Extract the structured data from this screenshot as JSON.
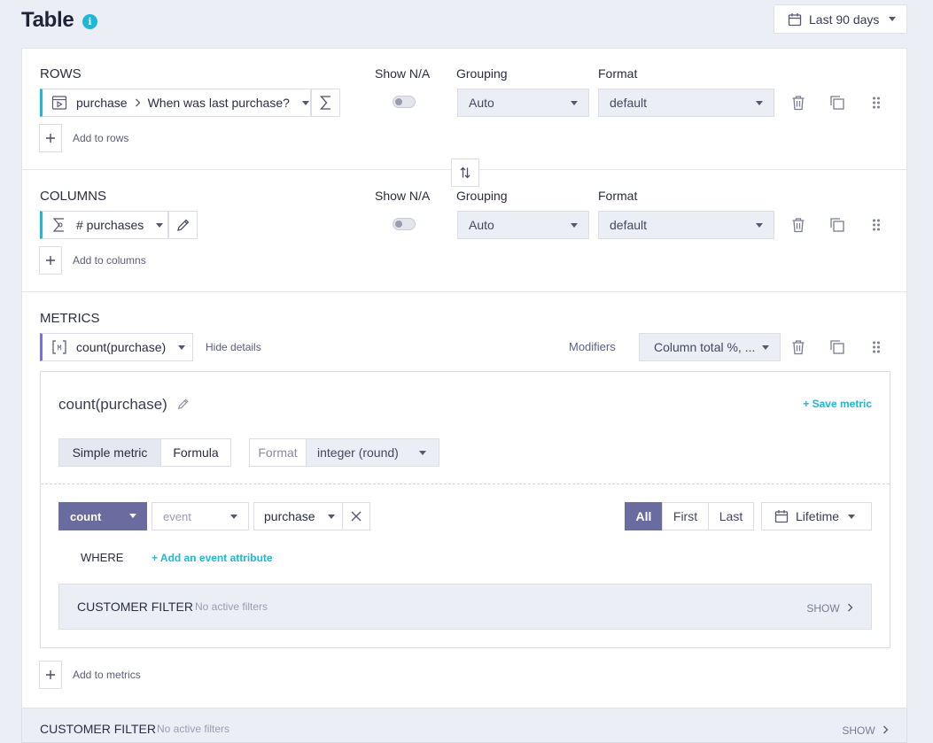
{
  "header": {
    "title": "Table",
    "info_icon": "info-icon",
    "date_range": "Last 90 days"
  },
  "columns_headers": {
    "show_na": "Show N/A",
    "grouping": "Grouping",
    "format": "Format"
  },
  "rows": {
    "title": "ROWS",
    "item": {
      "icon": "event-icon",
      "source": "purchase",
      "attribute": "When was last purchase?",
      "side_icon": "sigma-icon"
    },
    "grouping": "Auto",
    "format": "default",
    "add_label": "Add to rows"
  },
  "columns": {
    "title": "COLUMNS",
    "item": {
      "icon": "metric-icon",
      "label": "# purchases",
      "side_icon": "pencil-icon"
    },
    "grouping": "Auto",
    "format": "default",
    "add_label": "Add to columns"
  },
  "metrics": {
    "title": "METRICS",
    "item": {
      "icon": "metric-bracket-icon",
      "label": "count(purchase)"
    },
    "hide_details": "Hide details",
    "modifiers_label": "Modifiers",
    "modifiers_value": "Column total %, ...",
    "add_label": "Add to metrics",
    "details": {
      "name": "count(purchase)",
      "save_label": "+ Save metric",
      "tabs": [
        "Simple metric",
        "Formula"
      ],
      "active_tab": "Simple metric",
      "format_label": "Format",
      "format_value": "integer (round)",
      "function": "count",
      "event_placeholder": "event",
      "event_value": "purchase",
      "occurrence": [
        "All",
        "First",
        "Last"
      ],
      "active_occurrence": "All",
      "period": "Lifetime",
      "where_label": "WHERE",
      "add_attribute": "+ Add an event attribute",
      "customer_filter": {
        "title": "CUSTOMER FILTER",
        "status": "No active filters",
        "show": "SHOW"
      }
    }
  },
  "customer_filter": {
    "title": "CUSTOMER FILTER",
    "status": "No active filters",
    "show": "SHOW"
  },
  "colors": {
    "accent_cyan": "#1fb7d6",
    "accent_purple": "#6a6b9e",
    "background": "#eceef6"
  }
}
